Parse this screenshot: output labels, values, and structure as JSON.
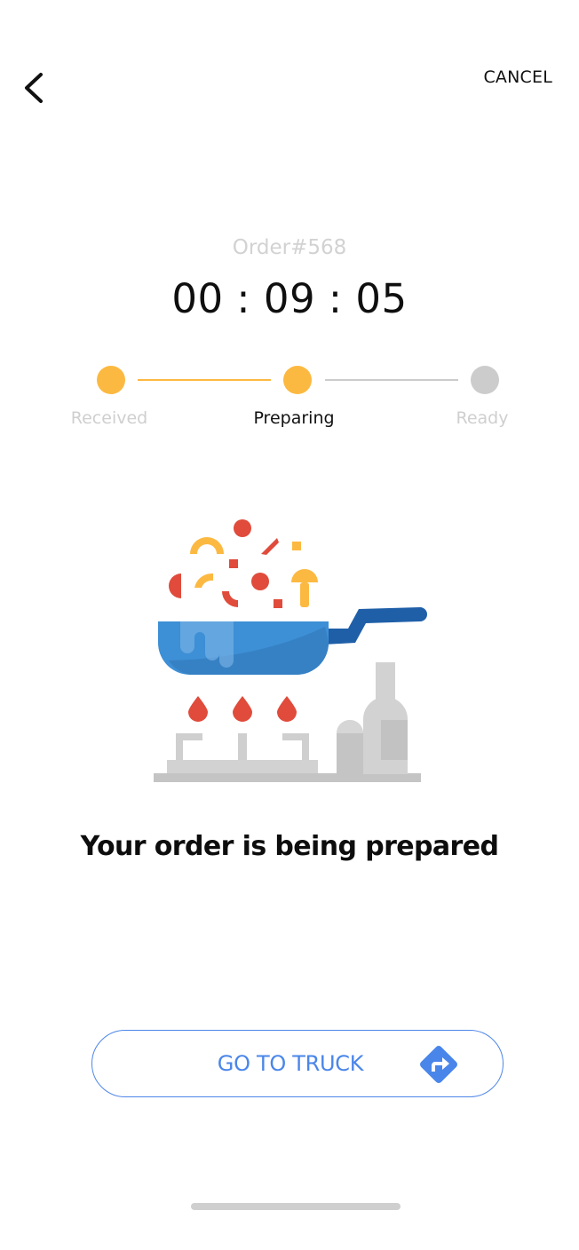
{
  "header": {
    "back_icon": "chevron-left-icon",
    "cancel_label": "CANCEL"
  },
  "order": {
    "number_label": "Order#568",
    "timer": "00 : 09 : 05"
  },
  "progress": {
    "current_step": 2,
    "steps": [
      {
        "label": "Received",
        "state": "done"
      },
      {
        "label": "Preparing",
        "state": "active"
      },
      {
        "label": "Ready",
        "state": "pending"
      }
    ],
    "colors": {
      "done": "#fcb941",
      "pending": "#cccccc",
      "label_inactive": "#cfcfcf",
      "label_active": "#111111"
    }
  },
  "illustration": {
    "icon": "cooking-pan-stove-illustration"
  },
  "status": {
    "headline": "Your order is being prepared"
  },
  "cta": {
    "label": "GO TO TRUCK",
    "icon": "directions-icon",
    "accent": "#4a86ea"
  }
}
